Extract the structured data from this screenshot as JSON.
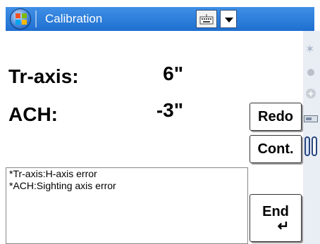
{
  "window": {
    "title": "Calibration"
  },
  "taskbar": {
    "start_icon": "windows-flag-icon",
    "keyboard_icon": "keyboard-icon",
    "dropdown_icon": "chevron-down-icon"
  },
  "readouts": [
    {
      "label": "Tr-axis:",
      "value": "6\""
    },
    {
      "label": "ACH:",
      "value": "-3\""
    }
  ],
  "buttons": {
    "redo": "Redo",
    "cont": "Cont.",
    "end": "End",
    "end_symbol": "↵"
  },
  "notes": [
    "*Tr-axis:H-axis error",
    "*ACH:Sighting axis error"
  ],
  "right_strip_icons": [
    "star-icon",
    "dot-icon",
    "plus-icon",
    "battery-icon",
    "pill-icon"
  ],
  "colors": {
    "titlebar": "#1f6fd1",
    "title_text": "#ffffff"
  }
}
